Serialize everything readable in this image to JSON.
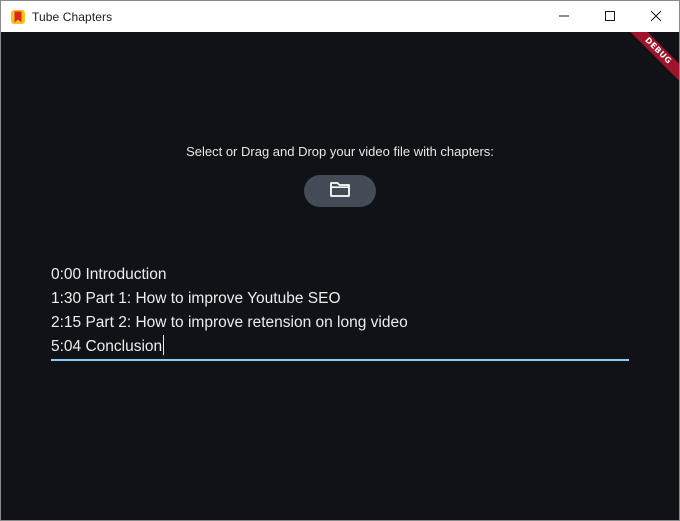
{
  "window": {
    "title": "Tube Chapters",
    "app_icon": "bookmark-app-icon",
    "controls": [
      "minimize-icon",
      "maximize-icon",
      "close-icon"
    ]
  },
  "debug_banner": {
    "label": "DEBUG",
    "color": "#a1122b"
  },
  "upload": {
    "prompt": "Select or Drag and Drop your video file with chapters:",
    "button_icon": "folder-icon"
  },
  "chapters": {
    "lines": [
      "0:00 Introduction",
      "1:30 Part 1: How to improve Youtube SEO",
      "2:15 Part 2: How to improve retension on long video",
      "5:04 Conclusion"
    ]
  },
  "colors": {
    "background": "#111217",
    "button": "#434b57",
    "focus_underline": "#8ecdf0"
  }
}
